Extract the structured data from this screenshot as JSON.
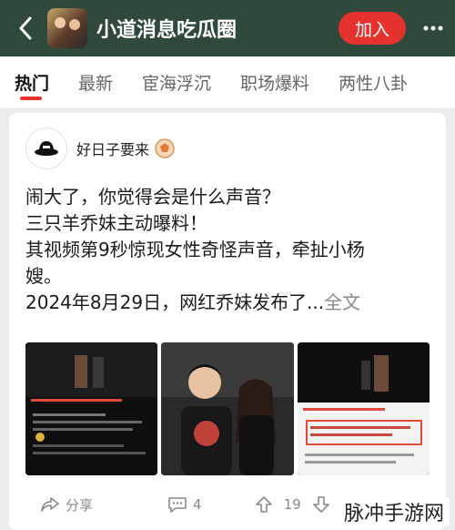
{
  "header": {
    "title": "小道消息吃瓜圈",
    "join_label": "加入",
    "bg_color": "#2f4a3c",
    "join_color": "#e5322e"
  },
  "tabs": [
    {
      "label": "热门",
      "active": true
    },
    {
      "label": "最新",
      "active": false
    },
    {
      "label": "宦海浮沉",
      "active": false
    },
    {
      "label": "职场爆料",
      "active": false
    },
    {
      "label": "两性八卦",
      "active": false
    }
  ],
  "post": {
    "author": "好日子要来",
    "lines": [
      "闹大了，你觉得会是什么声音？",
      "三只羊乔妹主动曝料！",
      "其视频第9秒惊现女性奇怪声音，牵扯小杨",
      "嫂。",
      "2024年8月29日，网红乔妹发布了..."
    ],
    "more_link": "全文"
  },
  "actions": {
    "share": "分享",
    "comments": "4",
    "votes": "19"
  },
  "watermark": "脉冲手游网"
}
